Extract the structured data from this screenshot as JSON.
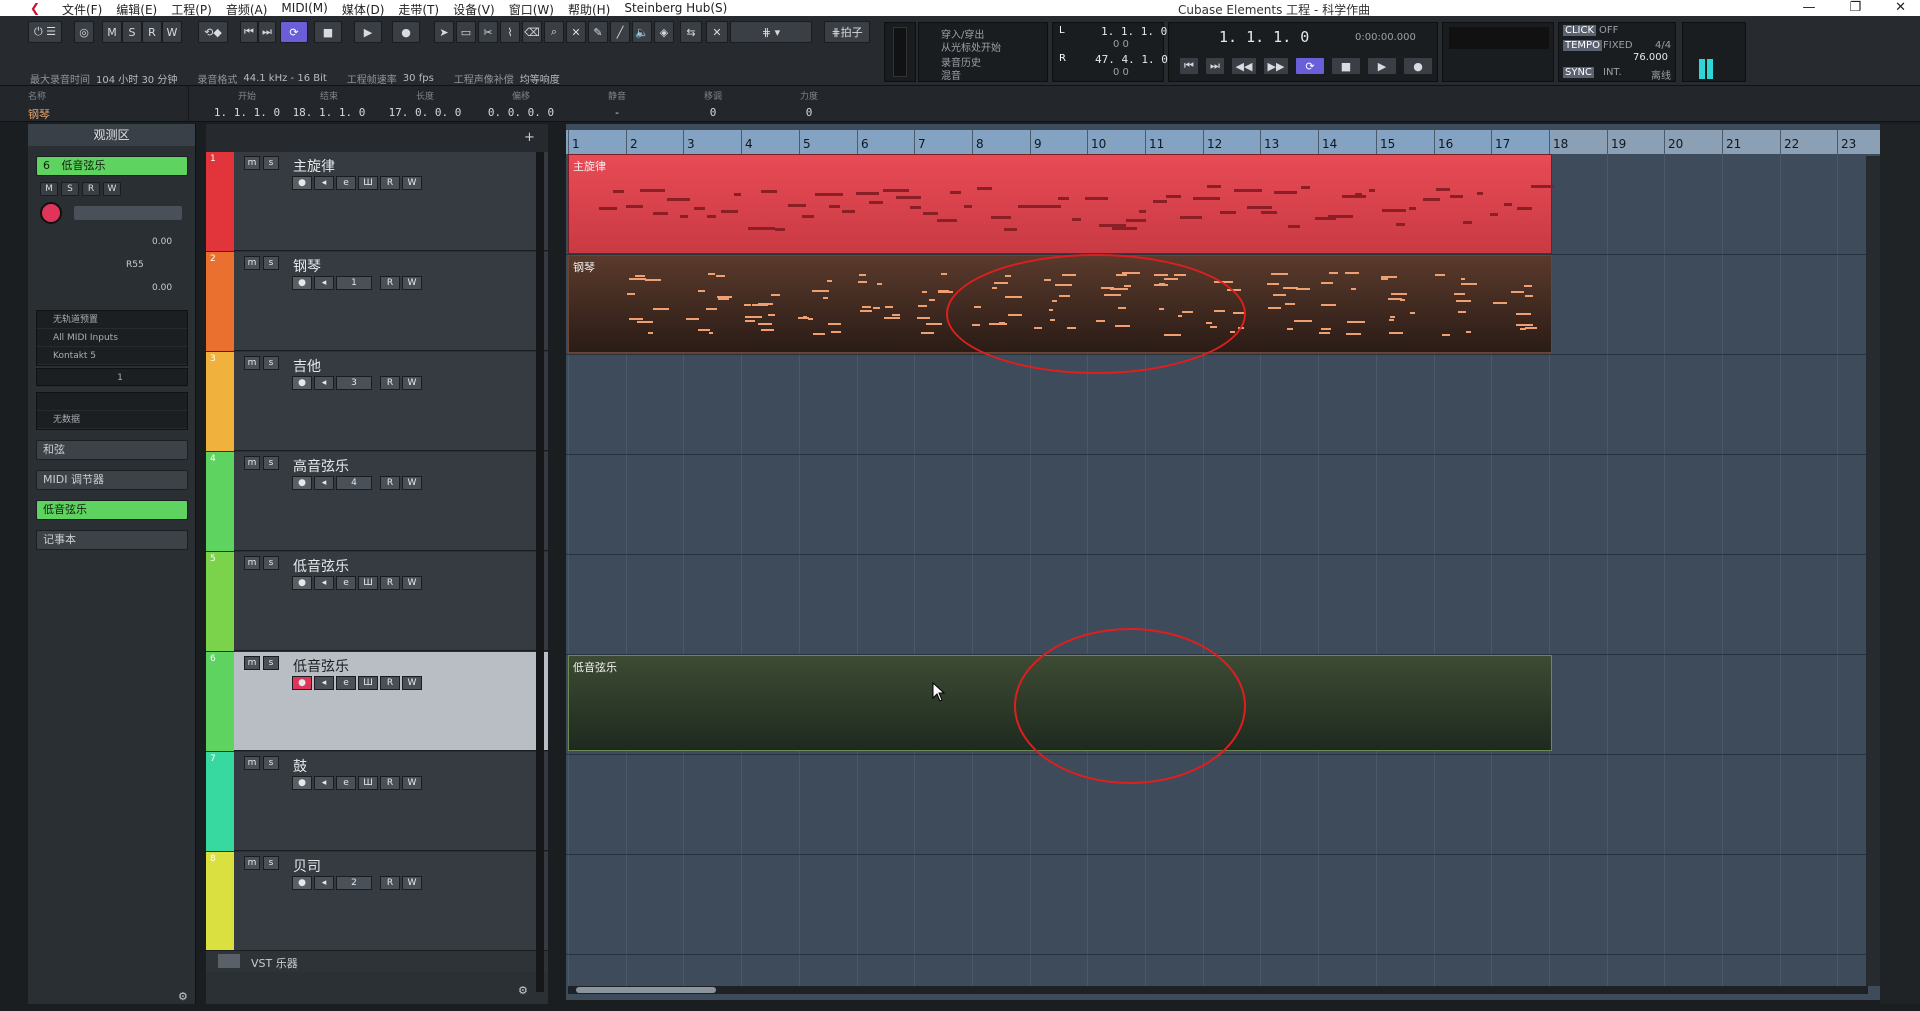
{
  "titlebar": {
    "menu": [
      "文件(F)",
      "编辑(E)",
      "工程(P)",
      "音频(A)",
      "MIDI(M)",
      "媒体(D)",
      "走带(T)",
      "设备(V)",
      "窗口(W)",
      "帮助(H)",
      "Steinberg Hub(S)"
    ],
    "window_title": "Cubase Elements 工程 - 科学作曲",
    "minimize": "—",
    "restore": "❐",
    "close": "✕"
  },
  "toolbar": {
    "ms_buttons": [
      "M",
      "S",
      "R",
      "W"
    ],
    "beat_label": "拍子",
    "info": [
      {
        "label": "最大录音时间",
        "value": "104 小时 30 分钟"
      },
      {
        "label": "录音格式",
        "value": "44.1 kHz - 16 Bit"
      },
      {
        "label": "工程帧速率",
        "value": "30 fps"
      },
      {
        "label": "工程声像补偿",
        "value": "均等响度"
      }
    ],
    "punch_panel": [
      "穿入/穿出",
      "从光标处开始",
      "录音历史",
      "混音"
    ],
    "locator_left": "1. 1. 1.   0",
    "locator_left_b": "0    0",
    "locator_right": "47. 4. 1.   0",
    "locator_right_b": "0    0",
    "position_bars": "1.  1.  1.    0",
    "position_time": "0:00:00.000",
    "click_label": "CLICK",
    "click_value": "OFF",
    "tempo_label": "TEMPO",
    "tempo_mode": "FIXED",
    "signature": "4/4",
    "tempo_value": "76.000",
    "sync_label": "SYNC",
    "sync_value": "INT.",
    "sync_extra": "离线"
  },
  "eventline": {
    "name_header": "名称",
    "name_value": "钢琴",
    "columns": [
      {
        "header": "开始",
        "value": "1. 1. 1.   0"
      },
      {
        "header": "结束",
        "value": "18. 1. 1.   0"
      },
      {
        "header": "长度",
        "value": "17. 0. 0.   0"
      },
      {
        "header": "偏移",
        "value": "0. 0. 0.   0"
      },
      {
        "header": "静音",
        "value": "-"
      },
      {
        "header": "移调",
        "value": "0"
      },
      {
        "header": "力度",
        "value": "0"
      }
    ]
  },
  "inspector": {
    "title": "观测区",
    "track_number": "6",
    "track_name": "低音弦乐",
    "ms_buttons": [
      "M",
      "S",
      "R",
      "W"
    ],
    "volume": "0.00",
    "pan": "R55",
    "delay": "0.00",
    "routing": [
      "无轨道预置",
      "All MIDI Inputs",
      "Kontakt 5"
    ],
    "channel": "1",
    "no_insert": "无数据",
    "sections": [
      "和弦",
      "MIDI 调节器",
      "低音弦乐",
      "记事本"
    ]
  },
  "tracks": [
    {
      "num": "1",
      "name": "主旋律",
      "color": "#e2343b",
      "slot": ""
    },
    {
      "num": "2",
      "name": "钢琴",
      "color": "#e9702f",
      "slot": "1"
    },
    {
      "num": "3",
      "name": "吉他",
      "color": "#f0b23c",
      "slot": "3"
    },
    {
      "num": "4",
      "name": "高音弦乐",
      "color": "#5fd35f",
      "slot": "4"
    },
    {
      "num": "5",
      "name": "低音弦乐",
      "color": "#7bd34b",
      "slot": ""
    },
    {
      "num": "6",
      "name": "低音弦乐",
      "color": "#5fd35f",
      "slot": ""
    },
    {
      "num": "7",
      "name": "鼓",
      "color": "#38d9a0",
      "slot": ""
    },
    {
      "num": "8",
      "name": "贝司",
      "color": "#d9e040",
      "slot": "2"
    }
  ],
  "vst_row": "VST 乐器",
  "arrange": {
    "bars": [
      "1",
      "2",
      "3",
      "4",
      "5",
      "6",
      "7",
      "8",
      "9",
      "10",
      "11",
      "12",
      "13",
      "14",
      "15",
      "16",
      "17",
      "18",
      "19",
      "20",
      "21",
      "22",
      "23"
    ],
    "parts": [
      {
        "name": "主旋律",
        "track": 0
      },
      {
        "name": "钢琴",
        "track": 1
      },
      {
        "name": "低音弦乐",
        "track": 5
      }
    ]
  },
  "colors": {
    "accent": "#6a5fd8",
    "annotation": "#e01e1e",
    "selected_track": "#b9bec4"
  }
}
